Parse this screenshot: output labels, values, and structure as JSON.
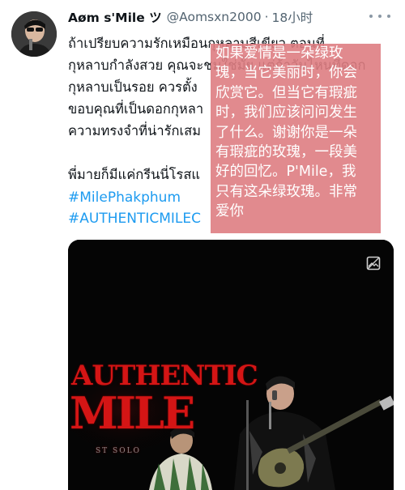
{
  "tweet": {
    "display_name": "Aøm s'Mile ツ",
    "handle": "@Aomsxn2000",
    "separator": "·",
    "time": "18小时",
    "text": "ถ้าเปรียบความรักเหมือนกุหลาบสีเขียว ตอนที่\nกุหลาบกำลังสวย คุณจะชมใช่มั้ย แต่ถ้าวันไหนที่ดอก\nกุหลาบเป็นรอย ควรตั้ง\nขอบคุณที่เป็นดอกกุหลา\nความทรงจำที่น่ารักเสม\n\nพี่มายก็มีแค่กรีนนี่โรสแ",
    "hashtags": [
      "#MilePhakphum",
      "#AUTHENTICMILEC"
    ]
  },
  "media": {
    "logo_line1": "AUTHENTIC",
    "logo_line2": "MILE",
    "logo_line3": "ST SOLO"
  },
  "translation_overlay": {
    "text": "如果爱情是一朵绿玫\n瑰，当它美丽时，你会\n欣赏它。但当它有瑕疵\n时，我们应该问问发生\n了什么。谢谢你是一朵\n有瑕疵的玫瑰，一段美\n好的回忆。P'Mile，我\n只有这朵绿玫瑰。非常\n爱你"
  },
  "colors": {
    "link": "#1d9bf0",
    "muted": "#536471",
    "overlay_pink": "#de7d82",
    "logo_red": "#d41515"
  }
}
